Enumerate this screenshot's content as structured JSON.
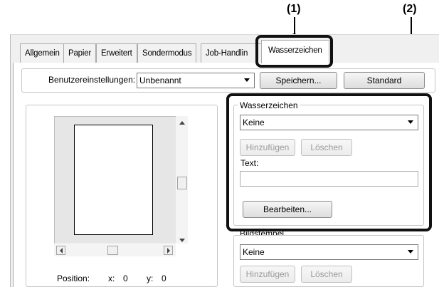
{
  "callouts": {
    "one": "(1)",
    "two": "(2)"
  },
  "tabs": [
    {
      "label": "Allgemein"
    },
    {
      "label": "Papier"
    },
    {
      "label": "Erweitert"
    },
    {
      "label": "Sondermodus"
    },
    {
      "label": "Job-Handlin"
    },
    {
      "label": "Wasserzeichen",
      "active": true
    }
  ],
  "user_settings": {
    "label": "Benutzereinstellungen:",
    "value": "Unbenannt",
    "save_button": "Speichern...",
    "default_button": "Standard"
  },
  "preview": {
    "position_label": "Position:",
    "x_label": "x:",
    "x_value": "0",
    "y_label": "y:",
    "y_value": "0"
  },
  "watermark": {
    "group_label": "Wasserzeichen",
    "select_value": "Keine",
    "add_button": "Hinzufügen",
    "delete_button": "Löschen",
    "text_label": "Text:",
    "text_value": "",
    "edit_button": "Bearbeiten..."
  },
  "image_stamp": {
    "group_label": "Bildstempel",
    "select_value": "Keine",
    "add_button": "Hinzufügen",
    "delete_button": "Löschen"
  }
}
